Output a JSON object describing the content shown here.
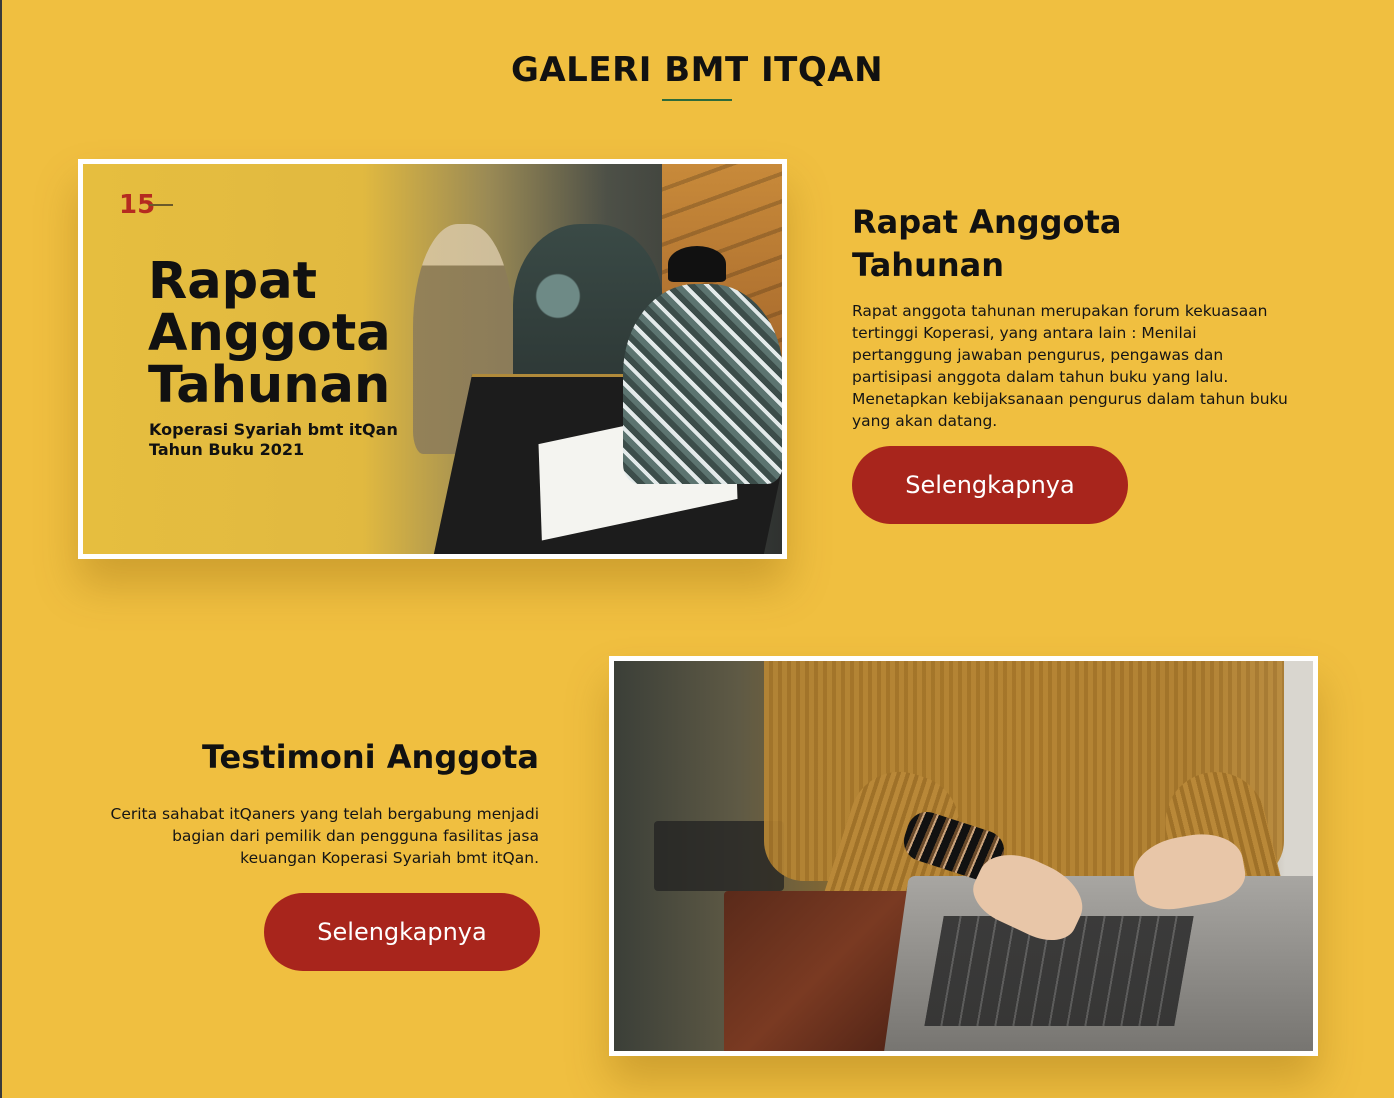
{
  "gallery": {
    "title": "GALERI BMT ITQAN"
  },
  "items": [
    {
      "title": "Rapat Anggota Tahunan",
      "description": "Rapat anggota tahunan merupakan forum kekuasaan tertinggi Koperasi, yang antara lain : Menilai pertanggung jawaban pengurus, pengawas dan partisipasi anggota dalam tahun buku yang lalu. Menetapkan kebijaksanaan pengurus dalam tahun buku yang akan datang.",
      "button": "Selengkapnya",
      "image": {
        "logo_text": "15",
        "title_lines": [
          "Rapat",
          "Anggota",
          "Tahunan"
        ],
        "subtitle_lines": [
          "Koperasi Syariah bmt itQan",
          "Tahun Buku 2021"
        ]
      }
    },
    {
      "title": "Testimoni Anggota",
      "description": "Cerita sahabat itQaners yang telah bergabung menjadi bagian dari pemilik dan pengguna fasilitas jasa keuangan Koperasi Syariah bmt itQan.",
      "button": "Selengkapnya"
    }
  ],
  "colors": {
    "background": "#F0BF40",
    "button": "#A8251C",
    "underline": "#2e6b3b"
  }
}
